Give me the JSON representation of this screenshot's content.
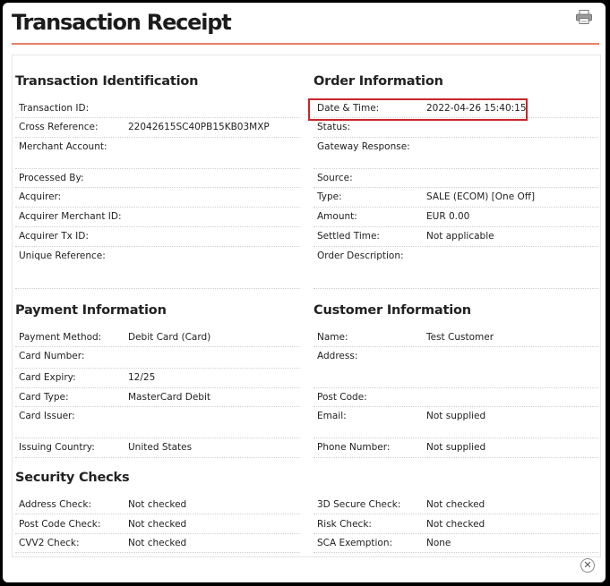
{
  "title": "Transaction Receipt",
  "sections": {
    "transaction_identification": "Transaction Identification",
    "order_information": "Order Information",
    "payment_information": "Payment Information",
    "customer_information": "Customer Information",
    "security_checks": "Security Checks"
  },
  "transaction": {
    "transaction_id": {
      "label": "Transaction ID:",
      "value": ""
    },
    "cross_reference": {
      "label": "Cross Reference:",
      "value": "22042615SC40PB15KB03MXP"
    },
    "merchant_account": {
      "label": "Merchant Account:",
      "value": ""
    },
    "processed_by": {
      "label": "Processed By:",
      "value": ""
    },
    "acquirer": {
      "label": "Acquirer:",
      "value": ""
    },
    "acquirer_merchant_id": {
      "label": "Acquirer Merchant ID:",
      "value": ""
    },
    "acquirer_tx_id": {
      "label": "Acquirer Tx ID:",
      "value": ""
    },
    "unique_reference": {
      "label": "Unique Reference:",
      "value": ""
    }
  },
  "order": {
    "date_time": {
      "label": "Date & Time:",
      "value": "2022-04-26 15:40:15"
    },
    "status": {
      "label": "Status:",
      "value": ""
    },
    "gateway_response": {
      "label": "Gateway Response:",
      "value": ""
    },
    "source": {
      "label": "Source:",
      "value": ""
    },
    "type": {
      "label": "Type:",
      "value": "SALE (ECOM) [One Off]"
    },
    "amount": {
      "label": "Amount:",
      "value": "EUR 0.00"
    },
    "settled_time": {
      "label": "Settled Time:",
      "value": "Not applicable"
    },
    "order_description": {
      "label": "Order Description:",
      "value": ""
    }
  },
  "payment": {
    "payment_method": {
      "label": "Payment Method:",
      "value": "Debit Card (Card)"
    },
    "card_number": {
      "label": "Card Number:",
      "value": ""
    },
    "card_expiry": {
      "label": "Card Expiry:",
      "value": "12/25"
    },
    "card_type": {
      "label": "Card Type:",
      "value": "MasterCard Debit"
    },
    "card_issuer": {
      "label": "Card Issuer:",
      "value": ""
    },
    "issuing_country": {
      "label": "Issuing Country:",
      "value": "United States"
    }
  },
  "customer": {
    "name": {
      "label": "Name:",
      "value": "Test Customer"
    },
    "address": {
      "label": "Address:",
      "value": ""
    },
    "post_code": {
      "label": "Post Code:",
      "value": ""
    },
    "email": {
      "label": "Email:",
      "value": "Not supplied"
    },
    "phone_number": {
      "label": "Phone Number:",
      "value": "Not supplied"
    }
  },
  "security": {
    "address_check": {
      "label": "Address Check:",
      "value": "Not checked"
    },
    "post_code_check": {
      "label": "Post Code Check:",
      "value": "Not checked"
    },
    "cvv2_check": {
      "label": "CVV2 Check:",
      "value": "Not checked"
    },
    "secure_3d_check": {
      "label": "3D Secure Check:",
      "value": "Not checked"
    },
    "risk_check": {
      "label": "Risk Check:",
      "value": "Not checked"
    },
    "sca_exemption": {
      "label": "SCA Exemption:",
      "value": "None"
    }
  },
  "icons": {
    "print": "printer-icon",
    "close": "close-icon"
  },
  "colors": {
    "accent_rule": "#e8806a",
    "highlight": "#c9252b"
  }
}
